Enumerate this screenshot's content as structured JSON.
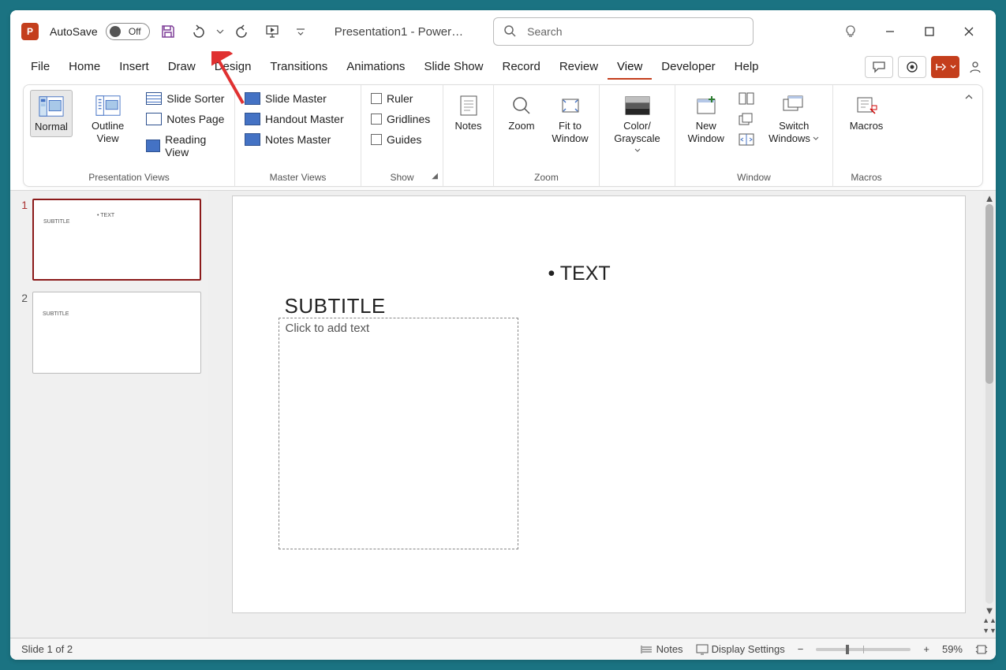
{
  "titlebar": {
    "autosave_label": "AutoSave",
    "autosave_state": "Off",
    "doc_title": "Presentation1  -  Power…",
    "search_placeholder": "Search"
  },
  "tabs": [
    "File",
    "Home",
    "Insert",
    "Draw",
    "Design",
    "Transitions",
    "Animations",
    "Slide Show",
    "Record",
    "Review",
    "View",
    "Developer",
    "Help"
  ],
  "active_tab": "View",
  "ribbon": {
    "presentation_views": {
      "label": "Presentation Views",
      "normal": "Normal",
      "outline_view": "Outline View",
      "slide_sorter": "Slide Sorter",
      "notes_page": "Notes Page",
      "reading_view": "Reading View"
    },
    "master_views": {
      "label": "Master Views",
      "slide_master": "Slide Master",
      "handout_master": "Handout Master",
      "notes_master": "Notes Master"
    },
    "show": {
      "label": "Show",
      "ruler": "Ruler",
      "gridlines": "Gridlines",
      "guides": "Guides"
    },
    "notes": {
      "label": "Notes"
    },
    "zoom": {
      "zoom": "Zoom",
      "fit": "Fit to Window",
      "label": "Zoom"
    },
    "color": {
      "btn": "Color/ Grayscale",
      "label": ""
    },
    "window": {
      "new_window": "New Window",
      "label": "Window",
      "switch": "Switch Windows"
    },
    "macros": {
      "btn": "Macros",
      "label": "Macros"
    }
  },
  "thumbs": [
    {
      "num": "1",
      "subtitle": "SUBTITLE",
      "bullet": "• TEXT",
      "selected": true
    },
    {
      "num": "2",
      "subtitle": "SUBTITLE",
      "bullet": "",
      "selected": false
    }
  ],
  "slide": {
    "bullet": "• TEXT",
    "subtitle": "SUBTITLE",
    "placeholder": "Click to add text"
  },
  "status": {
    "slide_pos": "Slide 1 of 2",
    "notes": "Notes",
    "display_settings": "Display Settings",
    "zoom_pct": "59%"
  }
}
